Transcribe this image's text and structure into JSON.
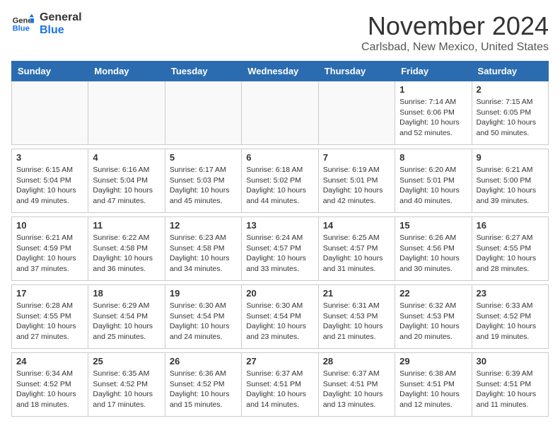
{
  "logo": {
    "line1": "General",
    "line2": "Blue"
  },
  "title": "November 2024",
  "location": "Carlsbad, New Mexico, United States",
  "weekdays": [
    "Sunday",
    "Monday",
    "Tuesday",
    "Wednesday",
    "Thursday",
    "Friday",
    "Saturday"
  ],
  "weeks": [
    [
      {
        "day": "",
        "info": ""
      },
      {
        "day": "",
        "info": ""
      },
      {
        "day": "",
        "info": ""
      },
      {
        "day": "",
        "info": ""
      },
      {
        "day": "",
        "info": ""
      },
      {
        "day": "1",
        "info": "Sunrise: 7:14 AM\nSunset: 6:06 PM\nDaylight: 10 hours\nand 52 minutes."
      },
      {
        "day": "2",
        "info": "Sunrise: 7:15 AM\nSunset: 6:05 PM\nDaylight: 10 hours\nand 50 minutes."
      }
    ],
    [
      {
        "day": "3",
        "info": "Sunrise: 6:15 AM\nSunset: 5:04 PM\nDaylight: 10 hours\nand 49 minutes."
      },
      {
        "day": "4",
        "info": "Sunrise: 6:16 AM\nSunset: 5:04 PM\nDaylight: 10 hours\nand 47 minutes."
      },
      {
        "day": "5",
        "info": "Sunrise: 6:17 AM\nSunset: 5:03 PM\nDaylight: 10 hours\nand 45 minutes."
      },
      {
        "day": "6",
        "info": "Sunrise: 6:18 AM\nSunset: 5:02 PM\nDaylight: 10 hours\nand 44 minutes."
      },
      {
        "day": "7",
        "info": "Sunrise: 6:19 AM\nSunset: 5:01 PM\nDaylight: 10 hours\nand 42 minutes."
      },
      {
        "day": "8",
        "info": "Sunrise: 6:20 AM\nSunset: 5:01 PM\nDaylight: 10 hours\nand 40 minutes."
      },
      {
        "day": "9",
        "info": "Sunrise: 6:21 AM\nSunset: 5:00 PM\nDaylight: 10 hours\nand 39 minutes."
      }
    ],
    [
      {
        "day": "10",
        "info": "Sunrise: 6:21 AM\nSunset: 4:59 PM\nDaylight: 10 hours\nand 37 minutes."
      },
      {
        "day": "11",
        "info": "Sunrise: 6:22 AM\nSunset: 4:58 PM\nDaylight: 10 hours\nand 36 minutes."
      },
      {
        "day": "12",
        "info": "Sunrise: 6:23 AM\nSunset: 4:58 PM\nDaylight: 10 hours\nand 34 minutes."
      },
      {
        "day": "13",
        "info": "Sunrise: 6:24 AM\nSunset: 4:57 PM\nDaylight: 10 hours\nand 33 minutes."
      },
      {
        "day": "14",
        "info": "Sunrise: 6:25 AM\nSunset: 4:57 PM\nDaylight: 10 hours\nand 31 minutes."
      },
      {
        "day": "15",
        "info": "Sunrise: 6:26 AM\nSunset: 4:56 PM\nDaylight: 10 hours\nand 30 minutes."
      },
      {
        "day": "16",
        "info": "Sunrise: 6:27 AM\nSunset: 4:55 PM\nDaylight: 10 hours\nand 28 minutes."
      }
    ],
    [
      {
        "day": "17",
        "info": "Sunrise: 6:28 AM\nSunset: 4:55 PM\nDaylight: 10 hours\nand 27 minutes."
      },
      {
        "day": "18",
        "info": "Sunrise: 6:29 AM\nSunset: 4:54 PM\nDaylight: 10 hours\nand 25 minutes."
      },
      {
        "day": "19",
        "info": "Sunrise: 6:30 AM\nSunset: 4:54 PM\nDaylight: 10 hours\nand 24 minutes."
      },
      {
        "day": "20",
        "info": "Sunrise: 6:30 AM\nSunset: 4:54 PM\nDaylight: 10 hours\nand 23 minutes."
      },
      {
        "day": "21",
        "info": "Sunrise: 6:31 AM\nSunset: 4:53 PM\nDaylight: 10 hours\nand 21 minutes."
      },
      {
        "day": "22",
        "info": "Sunrise: 6:32 AM\nSunset: 4:53 PM\nDaylight: 10 hours\nand 20 minutes."
      },
      {
        "day": "23",
        "info": "Sunrise: 6:33 AM\nSunset: 4:52 PM\nDaylight: 10 hours\nand 19 minutes."
      }
    ],
    [
      {
        "day": "24",
        "info": "Sunrise: 6:34 AM\nSunset: 4:52 PM\nDaylight: 10 hours\nand 18 minutes."
      },
      {
        "day": "25",
        "info": "Sunrise: 6:35 AM\nSunset: 4:52 PM\nDaylight: 10 hours\nand 17 minutes."
      },
      {
        "day": "26",
        "info": "Sunrise: 6:36 AM\nSunset: 4:52 PM\nDaylight: 10 hours\nand 15 minutes."
      },
      {
        "day": "27",
        "info": "Sunrise: 6:37 AM\nSunset: 4:51 PM\nDaylight: 10 hours\nand 14 minutes."
      },
      {
        "day": "28",
        "info": "Sunrise: 6:37 AM\nSunset: 4:51 PM\nDaylight: 10 hours\nand 13 minutes."
      },
      {
        "day": "29",
        "info": "Sunrise: 6:38 AM\nSunset: 4:51 PM\nDaylight: 10 hours\nand 12 minutes."
      },
      {
        "day": "30",
        "info": "Sunrise: 6:39 AM\nSunset: 4:51 PM\nDaylight: 10 hours\nand 11 minutes."
      }
    ]
  ]
}
